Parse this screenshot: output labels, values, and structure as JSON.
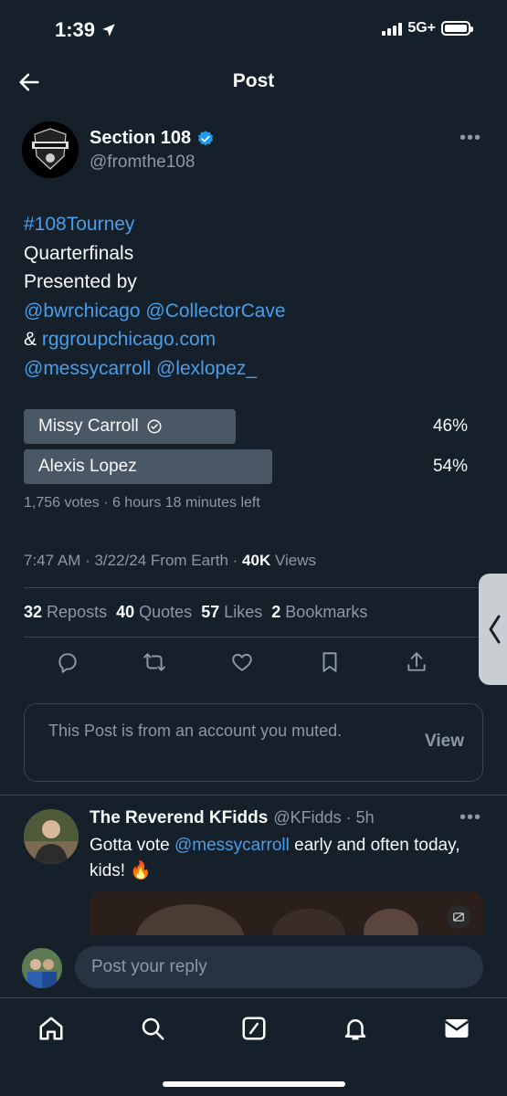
{
  "status_bar": {
    "time": "1:39",
    "network": "5G+"
  },
  "header": {
    "title": "Post"
  },
  "post": {
    "author_name": "Section 108",
    "author_handle": "@fromthe108",
    "lines": {
      "hashtag": "#108Tourney",
      "line2": "Quarterfinals",
      "line3": "Presented by",
      "mention1": "@bwrchicago",
      "mention2": "@CollectorCave",
      "amp": "&",
      "link": "rggroupchicago.com",
      "mention3": "@messycarroll",
      "mention4": "@lexlopez_"
    },
    "poll": {
      "options": [
        {
          "label": "Missy Carroll",
          "percent_text": "46%",
          "percent": 46,
          "selected": true
        },
        {
          "label": "Alexis Lopez",
          "percent_text": "54%",
          "percent": 54,
          "selected": false
        }
      ],
      "meta": "1,756 votes · 6 hours 18 minutes left"
    },
    "timestamp": "7:47 AM · 3/22/24 From Earth · ",
    "views_count": "40K",
    "views_label": " Views",
    "stats": {
      "reposts_count": "32",
      "reposts_label": "Reposts",
      "quotes_count": "40",
      "quotes_label": "Quotes",
      "likes_count": "57",
      "likes_label": "Likes",
      "bookmarks_count": "2",
      "bookmarks_label": "Bookmarks"
    }
  },
  "muted_notice": {
    "text": "This Post is from an account you muted.",
    "action": "View"
  },
  "reply": {
    "name": "The Reverend KFidds",
    "handle_time": "@KFidds · 5h",
    "text_before": "Gotta vote ",
    "mention": "@messycarroll",
    "text_after": " early and often today, kids! 🔥"
  },
  "composer": {
    "placeholder": "Post your reply"
  },
  "colors": {
    "background": "#15202b",
    "accent": "#4a9de8",
    "muted": "#8b98a5",
    "poll_bar": "#4a5866"
  }
}
